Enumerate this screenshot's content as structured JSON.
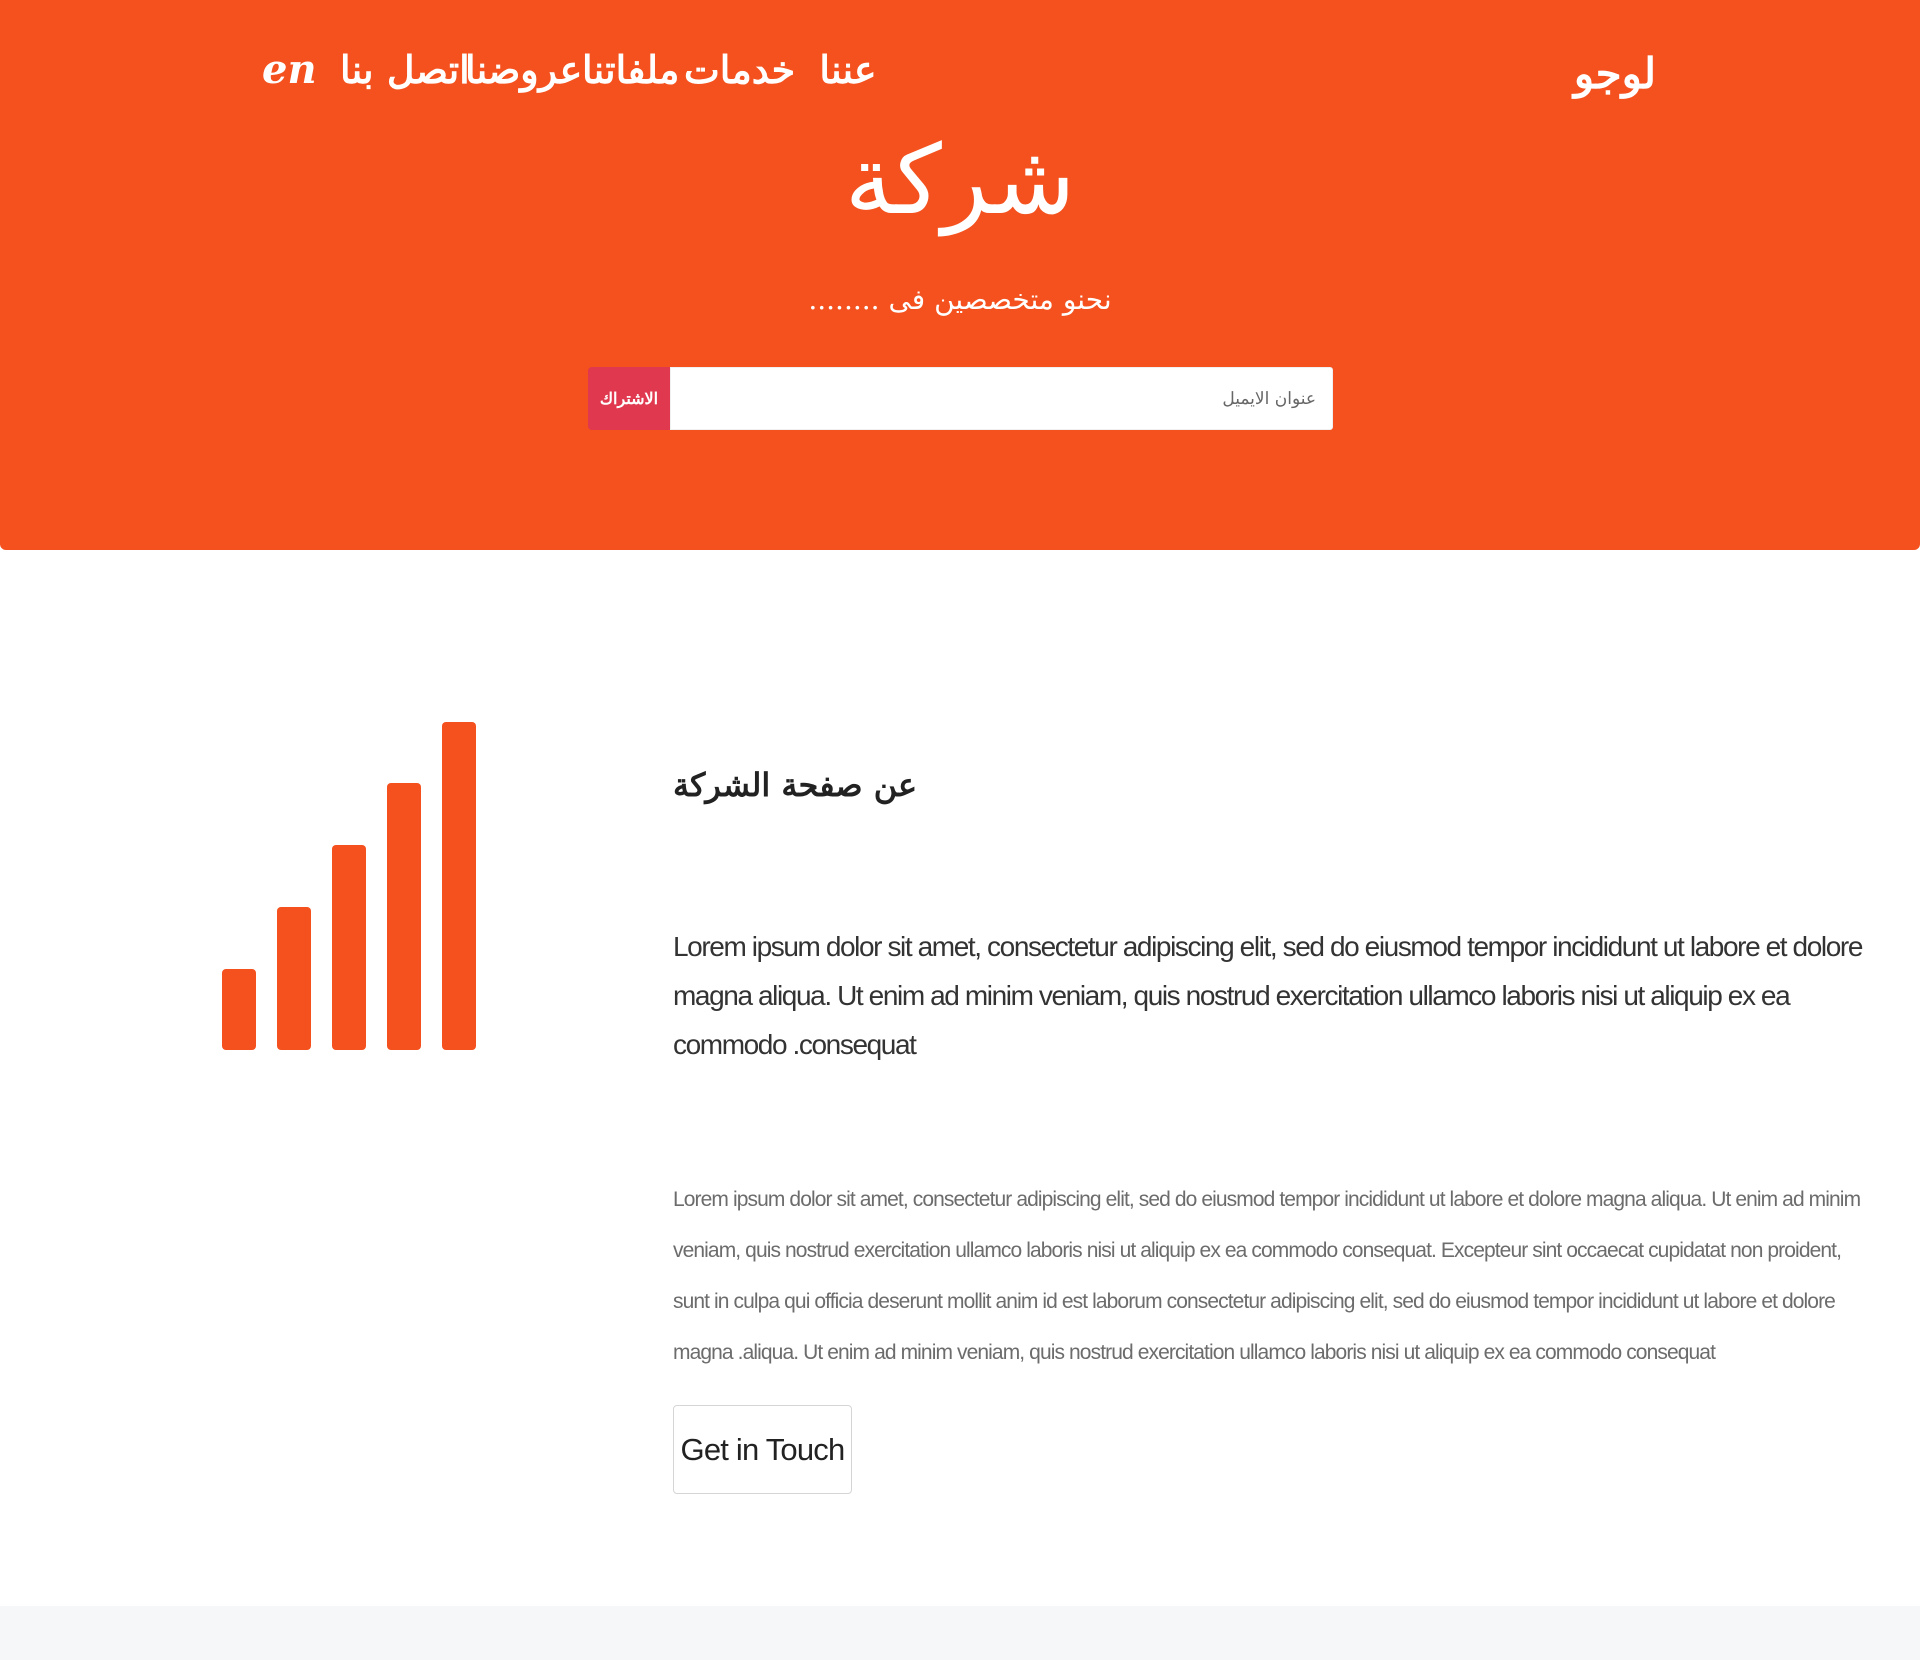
{
  "header": {
    "logo": "لوجو",
    "nav": [
      {
        "key": "about",
        "label": "عننا"
      },
      {
        "key": "services",
        "label": "خدمات"
      },
      {
        "key": "files",
        "label": "ملفاتنا"
      },
      {
        "key": "offers",
        "label": "عروضنا"
      },
      {
        "key": "contact",
        "label": "اتصل بنا"
      },
      {
        "key": "lang",
        "label": "en"
      }
    ],
    "brand": "شركة",
    "tagline": "نحنو متخصصين فى ........",
    "subscribe": {
      "placeholder": "عنوان الايميل",
      "button_label": "الاشتراك"
    }
  },
  "about": {
    "icon": "signal-bars-icon",
    "title": "عن صفحة الشركة",
    "lead": "Lorem ipsum dolor sit amet, consectetur adipiscing elit, sed do eiusmod tempor incididunt ut labore et dolore magna aliqua. Ut enim ad minim veniam, quis nostrud exercitation ullamco laboris nisi ut aliquip ex ea commodo .consequat",
    "body": "Lorem ipsum dolor sit amet, consectetur adipiscing elit, sed do eiusmod tempor incididunt ut labore et dolore magna aliqua. Ut enim ad minim veniam, quis nostrud exercitation ullamco laboris nisi ut aliquip ex ea commodo consequat. Excepteur sint occaecat cupidatat non proident, sunt in culpa qui officia deserunt mollit anim id est laborum consectetur adipiscing elit, sed do eiusmod tempor incididunt ut labore et dolore magna .aliqua. Ut enim ad minim veniam, quis nostrud exercitation ullamco laboris nisi ut aliquip ex ea commodo consequat",
    "cta_label": "Get in Touch"
  },
  "colors": {
    "accent": "#f4511e",
    "subscribe_button": "#e0384e",
    "footer_band": "#f6f7f9"
  }
}
